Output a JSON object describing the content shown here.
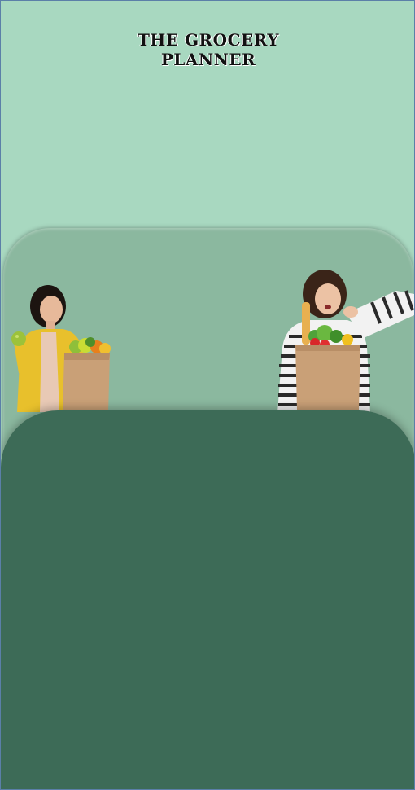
{
  "app": {
    "title_line1": "THE GROCERY",
    "title_line2": "PLANNER"
  },
  "images": {
    "left": "woman-holding-grocery-bag-left",
    "right": "woman-pointing-grocery-bag-right"
  },
  "colors": {
    "background": "#a8d8c0",
    "panel": "#8bb89f",
    "bottom_sheet": "#3d6b57"
  }
}
